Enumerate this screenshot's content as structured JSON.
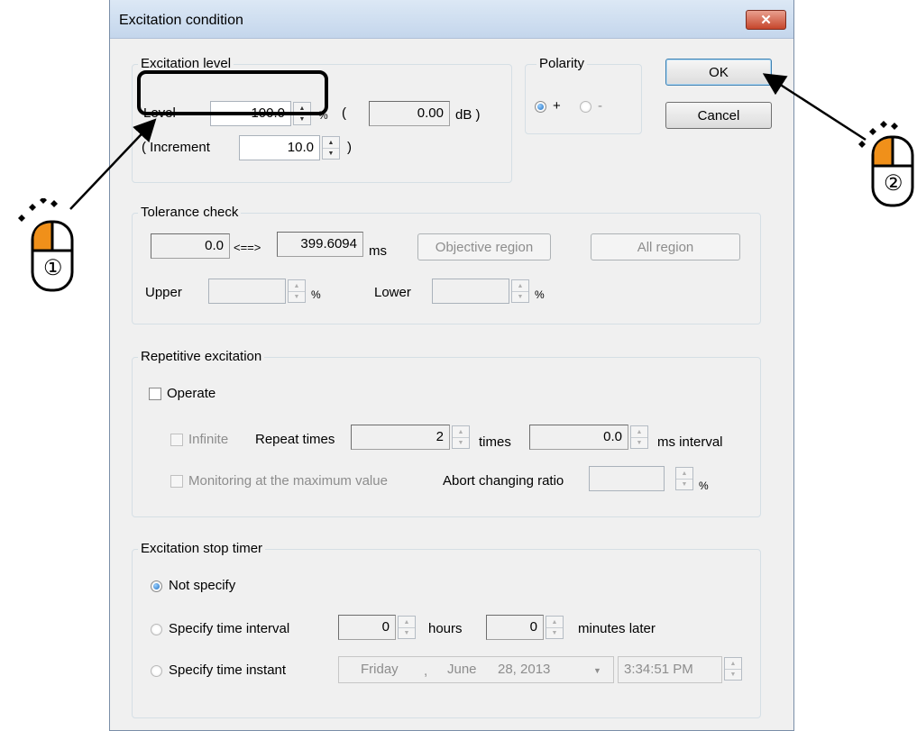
{
  "dialog": {
    "title": "Excitation condition",
    "close_glyph": "✕"
  },
  "excitation_level": {
    "legend": "Excitation level",
    "level_label": "Level",
    "level_value": "100.0",
    "level_unit": "%",
    "open_paren": "(",
    "db_value": "0.00",
    "db_unit": "dB )",
    "increment_label": "( Increment",
    "increment_value": "10.0",
    "close_paren": ")"
  },
  "polarity": {
    "legend": "Polarity",
    "plus_label": "+",
    "minus_label": "-",
    "selected": "+"
  },
  "buttons": {
    "ok": "OK",
    "cancel": "Cancel"
  },
  "tolerance": {
    "legend": "Tolerance check",
    "from": "0.0",
    "arrow": "<==>",
    "to": "399.6094",
    "unit": "ms",
    "objective_region": "Objective region",
    "all_region": "All region",
    "upper_label": "Upper",
    "upper_unit": "%",
    "lower_label": "Lower",
    "lower_unit": "%"
  },
  "repetitive": {
    "legend": "Repetitive excitation",
    "operate": "Operate",
    "infinite": "Infinite",
    "repeat_label": "Repeat times",
    "repeat_value": "2",
    "times_label": "times",
    "interval_value": "0.0",
    "interval_unit": "ms interval",
    "monitoring": "Monitoring at the maximum value",
    "abort_label": "Abort changing ratio",
    "abort_unit": "%"
  },
  "stop_timer": {
    "legend": "Excitation stop timer",
    "not_specify": "Not specify",
    "interval_label": "Specify time interval",
    "hours_value": "0",
    "hours_label": "hours",
    "minutes_value": "0",
    "minutes_label": "minutes later",
    "instant_label": "Specify time instant",
    "date_day": "Friday",
    "date_sep": ",",
    "date_month": "June",
    "date_daynum": "28, 2013",
    "time_value": "3:34:51 PM",
    "selected": "not_specify"
  },
  "annotations": {
    "step1": "①",
    "step2": "②"
  }
}
